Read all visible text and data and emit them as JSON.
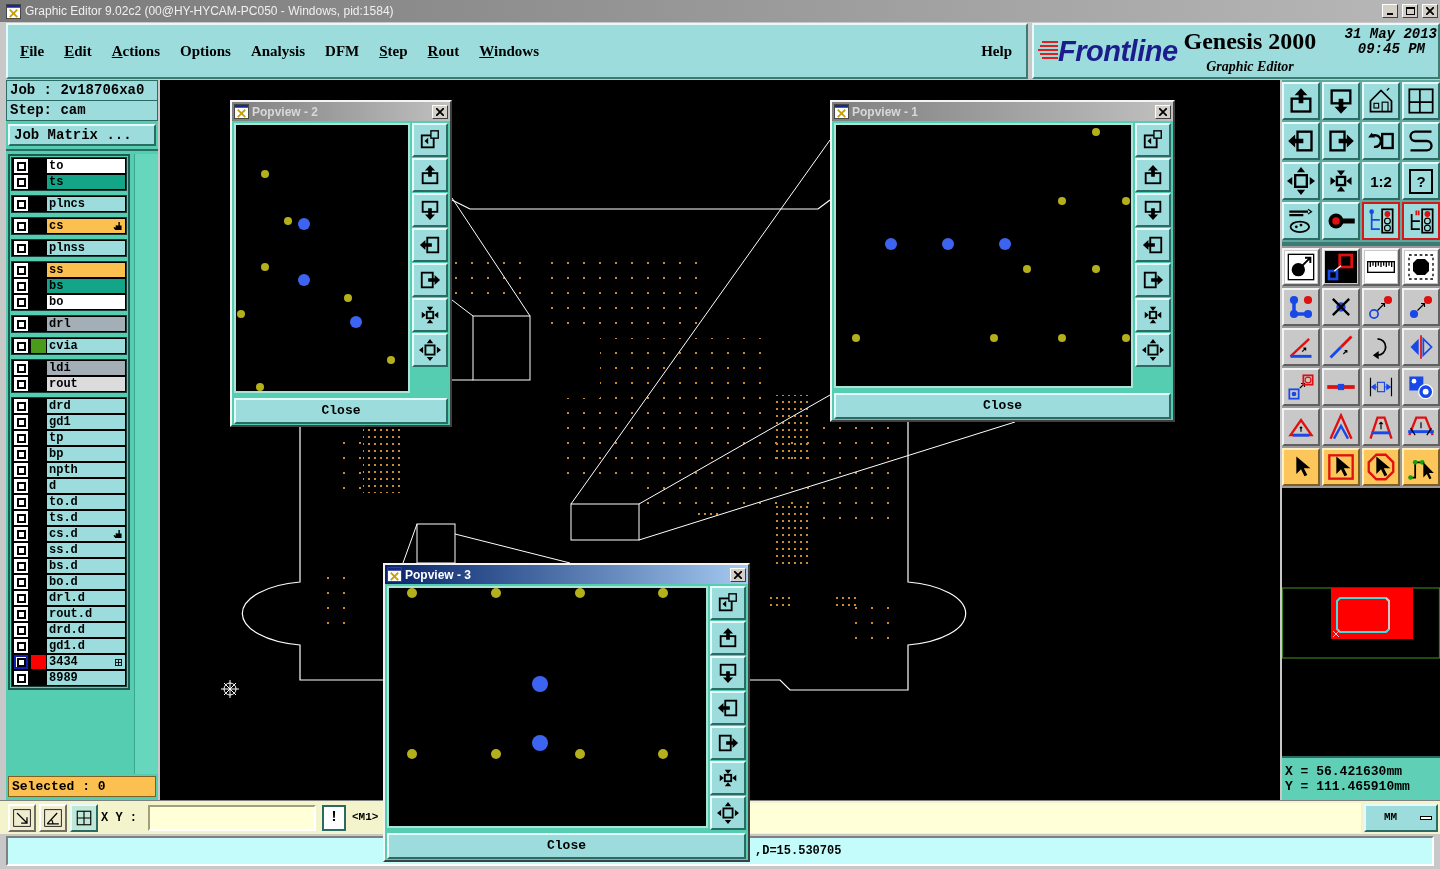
{
  "window": {
    "title": "Graphic Editor 9.02c2 (00@HY-HYCAM-PC050 - Windows, pid:1584)"
  },
  "menu": [
    {
      "label": "File",
      "mnemonic": true
    },
    {
      "label": "Edit",
      "mnemonic": true
    },
    {
      "label": "Actions",
      "mnemonic": true
    },
    {
      "label": "Options",
      "mnemonic": false
    },
    {
      "label": "Analysis",
      "mnemonic": false
    },
    {
      "label": "DFM",
      "mnemonic": false
    },
    {
      "label": "Step",
      "mnemonic": true
    },
    {
      "label": "Rout",
      "mnemonic": true
    },
    {
      "label": "Windows",
      "mnemonic": true
    }
  ],
  "help_menu": {
    "label": "Help",
    "mnemonic": false
  },
  "brand": {
    "logo": "Frontline",
    "product": "Genesis 2000",
    "subtitle": "Graphic Editor",
    "date": "31 May 2013",
    "time": "09:45 PM"
  },
  "job_panel": {
    "job": "Job : 2v18706xa0",
    "step": "Step: cam",
    "matrix_button": "Job Matrix ..."
  },
  "layer_groups": [
    {
      "layers": [
        {
          "name": "to",
          "kind": "plain",
          "color": "#ffffff",
          "checked": true,
          "selected": false
        },
        {
          "name": "ts",
          "kind": "plain",
          "color": "#14a589",
          "checked": true,
          "selected": false
        }
      ]
    },
    {
      "layers": [
        {
          "name": "plncs",
          "kind": "plain",
          "color": "#9ddcdc",
          "checked": true,
          "selected": false
        }
      ]
    },
    {
      "layers": [
        {
          "name": "cs",
          "kind": "hand",
          "color": "#fcc050",
          "checked": true,
          "selected": false
        }
      ]
    },
    {
      "layers": [
        {
          "name": "plnss",
          "kind": "plain",
          "color": "#9ddcdc",
          "checked": true,
          "selected": false
        }
      ]
    },
    {
      "layers": [
        {
          "name": "ss",
          "kind": "plain",
          "color": "#fcc050",
          "checked": true,
          "selected": false
        },
        {
          "name": "bs",
          "kind": "plain",
          "color": "#14a589",
          "checked": true,
          "selected": false
        },
        {
          "name": "bo",
          "kind": "plain",
          "color": "#ffffff",
          "checked": true,
          "selected": false
        }
      ]
    },
    {
      "layers": [
        {
          "name": "drl",
          "kind": "plain",
          "color": "#a4aeb6",
          "checked": true,
          "selected": false
        }
      ]
    },
    {
      "layers": [
        {
          "name": "cvia",
          "kind": "plain",
          "color": "#9ddcdc",
          "checked": true,
          "selected": false,
          "swatch": {
            "color": "#4a9a1c"
          }
        }
      ]
    },
    {
      "layers": [
        {
          "name": "ldi",
          "kind": "plain",
          "color": "#a4aeb6",
          "checked": true,
          "selected": false
        },
        {
          "name": "rout",
          "kind": "plain",
          "color": "#dcdcdc",
          "checked": true,
          "selected": false
        }
      ]
    },
    {
      "layers": [
        {
          "name": "drd",
          "kind": "plain",
          "color": "#9ddcdc",
          "checked": true,
          "selected": false
        },
        {
          "name": "gd1",
          "kind": "plain",
          "color": "#9ddcdc",
          "checked": true,
          "selected": false
        },
        {
          "name": "tp",
          "kind": "plain",
          "color": "#9ddcdc",
          "checked": true,
          "selected": false
        },
        {
          "name": "bp",
          "kind": "plain",
          "color": "#9ddcdc",
          "checked": true,
          "selected": false
        },
        {
          "name": "npth",
          "kind": "plain",
          "color": "#9ddcdc",
          "checked": true,
          "selected": false
        },
        {
          "name": "d",
          "kind": "plain",
          "color": "#9ddcdc",
          "checked": true,
          "selected": false
        },
        {
          "name": "to.d",
          "kind": "plain",
          "color": "#9ddcdc",
          "checked": true,
          "selected": false
        },
        {
          "name": "ts.d",
          "kind": "plain",
          "color": "#9ddcdc",
          "checked": true,
          "selected": false
        },
        {
          "name": "cs.d",
          "kind": "hand",
          "color": "#9ddcdc",
          "checked": true,
          "selected": false
        },
        {
          "name": "ss.d",
          "kind": "plain",
          "color": "#9ddcdc",
          "checked": true,
          "selected": false
        },
        {
          "name": "bs.d",
          "kind": "plain",
          "color": "#9ddcdc",
          "checked": true,
          "selected": false
        },
        {
          "name": "bo.d",
          "kind": "plain",
          "color": "#9ddcdc",
          "checked": true,
          "selected": false
        },
        {
          "name": "drl.d",
          "kind": "plain",
          "color": "#9ddcdc",
          "checked": true,
          "selected": false
        },
        {
          "name": "rout.d",
          "kind": "plain",
          "color": "#9ddcdc",
          "checked": true,
          "selected": false
        },
        {
          "name": "drd.d",
          "kind": "plain",
          "color": "#9ddcdc",
          "checked": true,
          "selected": false
        },
        {
          "name": "gd1.d",
          "kind": "plain",
          "color": "#9ddcdc",
          "checked": true,
          "selected": false
        },
        {
          "name": "3434",
          "kind": "grid",
          "color": "#9ddcdc",
          "checked": true,
          "selected": true,
          "swatch": {
            "color": "#ff0000"
          }
        },
        {
          "name": "8989",
          "kind": "plain",
          "color": "#9ddcdc",
          "checked": true,
          "selected": false
        }
      ]
    }
  ],
  "selection": "Selected : 0",
  "popviews": [
    {
      "title": "Popview - 2",
      "active": false,
      "close": "Close"
    },
    {
      "title": "Popview - 1",
      "active": false,
      "close": "Close"
    },
    {
      "title": "Popview - 3",
      "active": true,
      "close": "Close"
    }
  ],
  "view_tools": [
    {
      "on": false
    },
    {
      "on": false
    },
    {
      "on": false
    },
    {
      "on": false
    },
    {
      "on": false
    },
    {
      "on": false
    },
    {
      "on": false
    },
    {
      "on": false
    },
    {
      "on": false
    },
    {
      "on": false
    },
    {
      "label": "1:2",
      "on": false
    },
    {
      "label": "?",
      "on": false
    },
    {
      "on": false
    },
    {
      "on": false
    },
    {
      "on": true
    },
    {
      "on": true
    }
  ],
  "coordinates": {
    "x": "X = 56.421630mm",
    "y": "Y = 111.465910mm"
  },
  "command_bar": {
    "label": "X Y :",
    "alert_button": "!",
    "mode": "<M1>",
    "units": "MM"
  },
  "status_bar": {
    "text": ",D=15.530705"
  }
}
